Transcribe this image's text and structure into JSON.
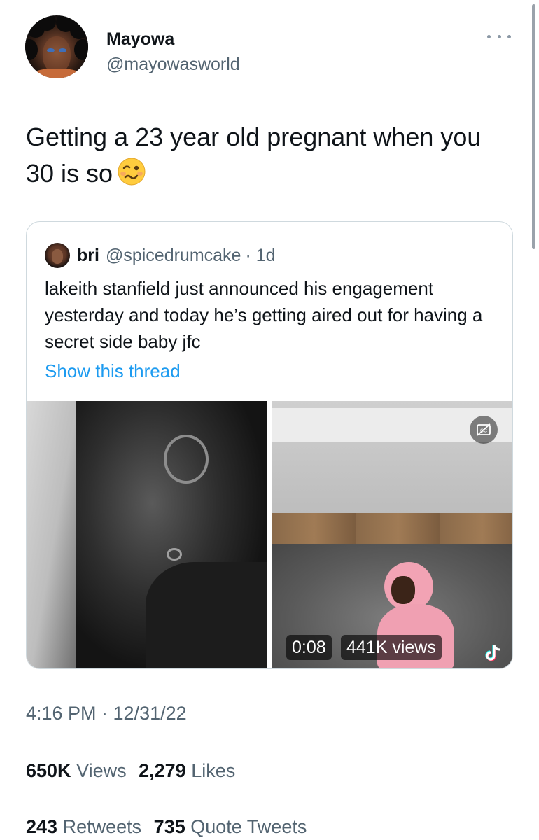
{
  "tweet": {
    "display_name": "Mayowa",
    "handle": "@mayowasworld",
    "text": "Getting a 23 year old pregnant when you 30 is so",
    "emoji": "woozy-face",
    "timestamp": "4:16 PM · 12/31/22"
  },
  "quote": {
    "display_name": "bri",
    "handle": "@spicedrumcake",
    "time": "· 1d",
    "text": "lakeith stanfield just announced his engagement yesterday and today he’s getting aired out for having a secret side baby jfc",
    "show_thread": "Show this thread",
    "video": {
      "duration": "0:08",
      "views": "441K views"
    }
  },
  "stats": {
    "views_count": "650K",
    "views_label": "Views",
    "likes_count": "2,279",
    "likes_label": "Likes",
    "retweets_count": "243",
    "retweets_label": "Retweets",
    "quotes_count": "735",
    "quotes_label": "Quote Tweets"
  },
  "colors": {
    "link": "#1d9bf0",
    "secondary_text": "#536471",
    "primary_text": "#0f1419",
    "border": "#cfd9de"
  }
}
